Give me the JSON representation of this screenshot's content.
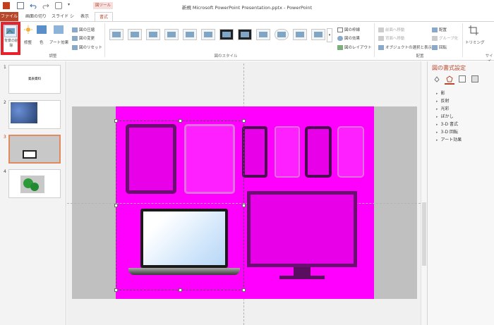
{
  "window": {
    "title": "新規 Microsoft PowerPoint Presentation.pptx - PowerPoint",
    "context_tab_group": "図ツール"
  },
  "tabs": [
    "ファイル",
    "画面の切り替え",
    "スライド ショー",
    "表示",
    "書式"
  ],
  "ribbon": {
    "adjust_group": {
      "label": "調整",
      "remove_background": "背景の削除",
      "corrections": "修整",
      "color": "色",
      "artistic_effects": "アート効果",
      "compress": "図の圧縮",
      "change_picture": "図の変更",
      "reset_picture": "図のリセット"
    },
    "styles_group": {
      "label": "図のスタイル",
      "border": "図の枠線",
      "effects": "図の効果",
      "layout": "図のレイアウト"
    },
    "arrange_group": {
      "label": "配置",
      "bring_forward": "前面へ移動",
      "send_backward": "背面へ移動",
      "selection_pane": "オブジェクトの選択と表示",
      "align": "配置",
      "group": "グループ化",
      "rotate": "回転"
    },
    "size_group": {
      "label": "サイズ",
      "crop": "トリミング"
    }
  },
  "slides": [
    {
      "number": "1",
      "title": "発表資料"
    },
    {
      "number": "2",
      "title": ""
    },
    {
      "number": "3",
      "title": ""
    },
    {
      "number": "4",
      "title": ""
    }
  ],
  "format_pane": {
    "title": "図の書式設定",
    "sections": [
      "影",
      "反射",
      "光彩",
      "ぼかし",
      "3-D 書式",
      "3-D 回転",
      "アート効果"
    ]
  },
  "colors": {
    "accent": "#b7472a",
    "highlight": "#e8212b",
    "picture_background": "#ff00ff"
  }
}
